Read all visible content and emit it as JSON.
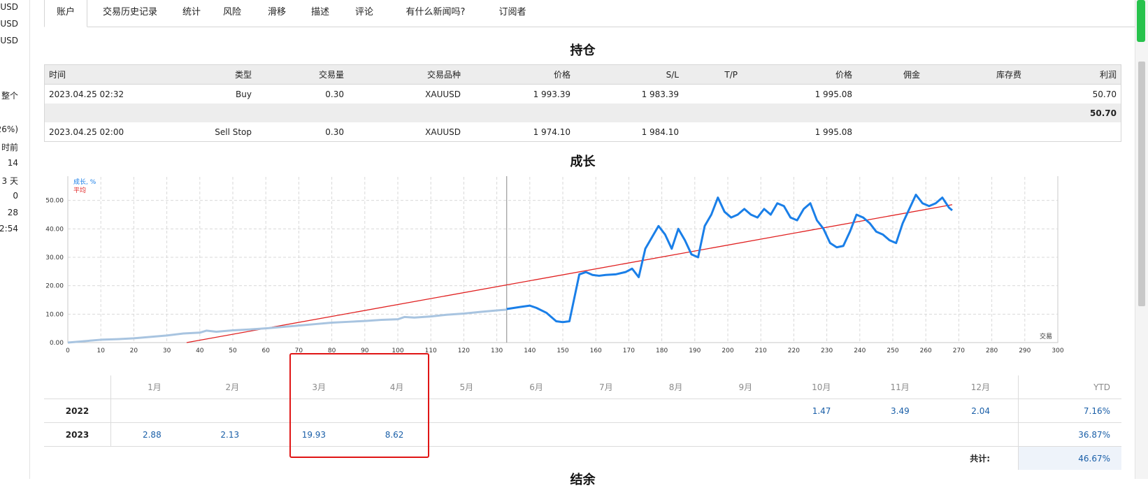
{
  "sidebar_fragments": [
    "USD",
    "USD",
    "USD",
    "整个",
    "26%)",
    "时前",
    "14",
    "3 天",
    "0",
    "28",
    "2:54"
  ],
  "tabs": [
    "账户",
    "交易历史记录",
    "统计",
    "风险",
    "滑移",
    "描述",
    "评论",
    "有什么新闻吗?",
    "订阅者"
  ],
  "positions": {
    "title": "持仓",
    "headers": [
      "时间",
      "类型",
      "交易量",
      "交易品种",
      "价格",
      "S/L",
      "T/P",
      "价格",
      "佣金",
      "库存费",
      "利润"
    ],
    "rows": [
      [
        "2023.04.25 02:32",
        "Buy",
        "0.30",
        "XAUUSD",
        "1 993.39",
        "1 983.39",
        "",
        "1 995.08",
        "",
        "",
        "50.70"
      ],
      [
        "",
        "",
        "",
        "",
        "",
        "",
        "",
        "",
        "",
        "",
        "50.70"
      ],
      [
        "2023.04.25 02:00",
        "Sell Stop",
        "0.30",
        "XAUUSD",
        "1 974.10",
        "1 984.10",
        "",
        "1 995.08",
        "",
        "",
        ""
      ]
    ]
  },
  "growth_title": "成长",
  "chart_data": {
    "type": "line",
    "legend": [
      "成长, %",
      "平均"
    ],
    "xlabel": "交易",
    "xlim": [
      0,
      300
    ],
    "ylim": [
      0,
      60
    ],
    "xticks": [
      0,
      10,
      20,
      30,
      40,
      50,
      60,
      70,
      80,
      90,
      100,
      110,
      120,
      130,
      140,
      150,
      160,
      170,
      180,
      190,
      200,
      210,
      220,
      230,
      240,
      250,
      260,
      270,
      280,
      290,
      300
    ],
    "yticks": [
      "0.00",
      "10.00",
      "20.00",
      "30.00",
      "40.00",
      "50.00",
      "60.00"
    ],
    "months": [
      "1月",
      "2月",
      "3月",
      "4月",
      "5月",
      "6月",
      "7月",
      "8月",
      "9月",
      "10月",
      "11月",
      "12月"
    ],
    "history_series": {
      "name": "成长, %",
      "x": [
        0,
        5,
        10,
        15,
        20,
        25,
        30,
        35,
        40,
        42,
        45,
        50,
        55,
        60,
        65,
        70,
        75,
        80,
        85,
        90,
        95,
        100,
        102,
        105,
        110,
        115,
        120,
        125,
        130,
        133
      ],
      "y": [
        0,
        0.5,
        1,
        1.2,
        1.5,
        2,
        2.5,
        3.2,
        3.5,
        4.2,
        3.8,
        4.3,
        4.6,
        5,
        5.5,
        6,
        6.5,
        7,
        7.3,
        7.6,
        8,
        8.2,
        9,
        8.8,
        9.2,
        9.8,
        10.2,
        10.8,
        11.3,
        11.6
      ]
    },
    "growth_series": {
      "name": "成长, %",
      "x": [
        133,
        137,
        140,
        142,
        145,
        148,
        150,
        152,
        155,
        157,
        159,
        161,
        163,
        166,
        169,
        171,
        173,
        175,
        177,
        179,
        181,
        183,
        185,
        187,
        189,
        191,
        193,
        195,
        197,
        199,
        201,
        203,
        205,
        207,
        209,
        211,
        213,
        215,
        217,
        219,
        221,
        223,
        225,
        227,
        229,
        231,
        233,
        235,
        237,
        239,
        241,
        243,
        245,
        247,
        249,
        251,
        253,
        255,
        257,
        259,
        261,
        263,
        265,
        267,
        268
      ],
      "y": [
        11.8,
        12.5,
        13,
        12.2,
        10.5,
        7.5,
        7.2,
        7.5,
        24,
        24.8,
        23.8,
        23.5,
        23.8,
        24,
        24.8,
        26,
        23,
        33,
        37,
        41,
        38,
        33,
        40,
        36,
        31,
        30,
        41,
        45,
        51,
        46,
        44,
        45,
        47,
        45,
        44,
        47,
        45,
        49,
        48,
        44,
        43,
        47,
        49,
        43,
        40,
        35,
        33.5,
        34,
        39,
        45,
        44,
        42,
        39,
        38,
        36,
        35,
        42,
        47,
        52,
        49,
        48,
        49,
        51,
        47.5,
        46.5
      ]
    },
    "average_series": {
      "name": "平均",
      "x": [
        36,
        268
      ],
      "y": [
        0,
        48.5
      ]
    },
    "current_marker_x": 133
  },
  "monthly": {
    "months": [
      "1月",
      "2月",
      "3月",
      "4月",
      "5月",
      "6月",
      "7月",
      "8月",
      "9月",
      "10月",
      "11月",
      "12月"
    ],
    "ytd_label": "YTD",
    "rows": [
      {
        "year": "2022",
        "values": [
          "",
          "",
          "",
          "",
          "",
          "",
          "",
          "",
          "",
          "1.47",
          "3.49",
          "2.04"
        ],
        "ytd": "7.16%"
      },
      {
        "year": "2023",
        "values": [
          "2.88",
          "2.13",
          "19.93",
          "8.62",
          "",
          "",
          "",
          "",
          "",
          "",
          "",
          ""
        ],
        "ytd": "36.87%"
      }
    ],
    "total_label": "共计:",
    "total_value": "46.67%"
  },
  "next_section_title": "结余",
  "colors": {
    "growth": "#1a7fe8",
    "history": "#a8c4e0",
    "average": "#e02020",
    "highlight": "#e01515"
  }
}
